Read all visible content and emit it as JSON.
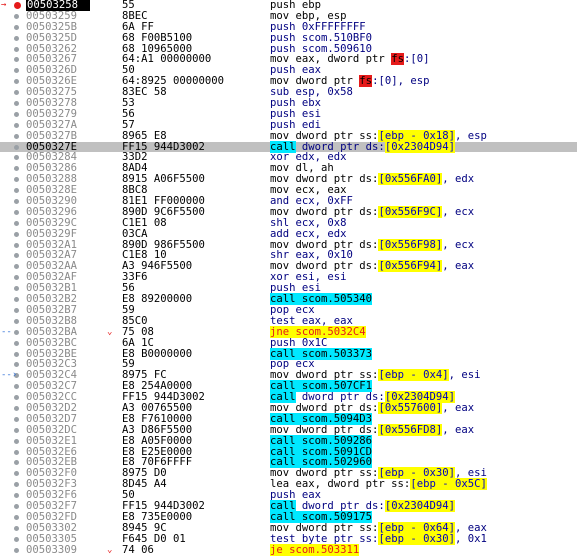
{
  "rows": [
    {
      "addr": "00503258",
      "bytes": "55",
      "ins": [
        {
          "t": "push ebp",
          "k": "mov"
        }
      ],
      "current": true,
      "bp": "red"
    },
    {
      "addr": "00503259",
      "bytes": "8BEC",
      "ins": [
        {
          "t": "mov ebp, esp",
          "k": "mov"
        }
      ]
    },
    {
      "addr": "0050325B",
      "bytes": "6A FF",
      "ins": [
        {
          "t": "push 0xFFFFFFFF",
          "k": "def"
        }
      ]
    },
    {
      "addr": "0050325D",
      "bytes": "68 F00B5100",
      "ins": [
        {
          "t": "push scom.510BF0",
          "k": "def"
        }
      ]
    },
    {
      "addr": "00503262",
      "bytes": "68 10965000",
      "ins": [
        {
          "t": "push scom.509610",
          "k": "def"
        }
      ]
    },
    {
      "addr": "00503267",
      "bytes": "64:A1 00000000",
      "ins": [
        {
          "t": "mov eax, dword ptr ",
          "k": "mov"
        },
        {
          "t": "fs",
          "k": "fs"
        },
        {
          "t": ":[0]",
          "k": "def"
        }
      ]
    },
    {
      "addr": "0050326D",
      "bytes": "50",
      "ins": [
        {
          "t": "push eax",
          "k": "def"
        }
      ]
    },
    {
      "addr": "0050326E",
      "bytes": "64:8925 00000000",
      "ins": [
        {
          "t": "mov dword ptr ",
          "k": "mov"
        },
        {
          "t": "fs",
          "k": "fs"
        },
        {
          "t": ":[0], esp",
          "k": "def"
        }
      ]
    },
    {
      "addr": "00503275",
      "bytes": "83EC 58",
      "ins": [
        {
          "t": "sub esp, 0x58",
          "k": "def"
        }
      ]
    },
    {
      "addr": "00503278",
      "bytes": "53",
      "ins": [
        {
          "t": "push ebx",
          "k": "def"
        }
      ]
    },
    {
      "addr": "00503279",
      "bytes": "56",
      "ins": [
        {
          "t": "push esi",
          "k": "def"
        }
      ]
    },
    {
      "addr": "0050327A",
      "bytes": "57",
      "ins": [
        {
          "t": "push edi",
          "k": "def"
        }
      ]
    },
    {
      "addr": "0050327B",
      "bytes": "8965 E8",
      "ins": [
        {
          "t": "mov dword ptr ss:",
          "k": "mov"
        },
        {
          "t": "[ebp - 0x18]",
          "k": "mem"
        },
        {
          "t": ", esp",
          "k": "def"
        }
      ]
    },
    {
      "addr": "0050327E",
      "bytes": "FF15 944D3002",
      "ins": [
        {
          "t": "call",
          "k": "call"
        },
        {
          "t": " dword ptr ds:",
          "k": "def"
        },
        {
          "t": "[0x2304D94]",
          "k": "mem"
        }
      ],
      "selected": true
    },
    {
      "addr": "00503284",
      "bytes": "33D2",
      "ins": [
        {
          "t": "xor edx, edx",
          "k": "def"
        }
      ]
    },
    {
      "addr": "00503286",
      "bytes": "8AD4",
      "ins": [
        {
          "t": "mov dl, ah",
          "k": "mov"
        }
      ]
    },
    {
      "addr": "00503288",
      "bytes": "8915 A06F5500",
      "ins": [
        {
          "t": "mov dword ptr ds:",
          "k": "mov"
        },
        {
          "t": "[0x556FA0]",
          "k": "mem"
        },
        {
          "t": ", edx",
          "k": "def"
        }
      ]
    },
    {
      "addr": "0050328E",
      "bytes": "8BC8",
      "ins": [
        {
          "t": "mov ecx, eax",
          "k": "mov"
        }
      ]
    },
    {
      "addr": "00503290",
      "bytes": "81E1 FF000000",
      "ins": [
        {
          "t": "and ecx, 0xFF",
          "k": "def"
        }
      ]
    },
    {
      "addr": "00503296",
      "bytes": "890D 9C6F5500",
      "ins": [
        {
          "t": "mov dword ptr ds:",
          "k": "mov"
        },
        {
          "t": "[0x556F9C]",
          "k": "mem"
        },
        {
          "t": ", ecx",
          "k": "def"
        }
      ]
    },
    {
      "addr": "0050329C",
      "bytes": "C1E1 08",
      "ins": [
        {
          "t": "shl ecx, 0x8",
          "k": "def"
        }
      ]
    },
    {
      "addr": "0050329F",
      "bytes": "03CA",
      "ins": [
        {
          "t": "add ecx, edx",
          "k": "def"
        }
      ]
    },
    {
      "addr": "005032A1",
      "bytes": "890D 986F5500",
      "ins": [
        {
          "t": "mov dword ptr ds:",
          "k": "mov"
        },
        {
          "t": "[0x556F98]",
          "k": "mem"
        },
        {
          "t": ", ecx",
          "k": "def"
        }
      ]
    },
    {
      "addr": "005032A7",
      "bytes": "C1E8 10",
      "ins": [
        {
          "t": "shr eax, 0x10",
          "k": "def"
        }
      ]
    },
    {
      "addr": "005032AA",
      "bytes": "A3 946F5500",
      "ins": [
        {
          "t": "mov dword ptr ds:",
          "k": "mov"
        },
        {
          "t": "[0x556F94]",
          "k": "mem"
        },
        {
          "t": ", eax",
          "k": "def"
        }
      ]
    },
    {
      "addr": "005032AF",
      "bytes": "33F6",
      "ins": [
        {
          "t": "xor esi, esi",
          "k": "def"
        }
      ]
    },
    {
      "addr": "005032B1",
      "bytes": "56",
      "ins": [
        {
          "t": "push esi",
          "k": "def"
        }
      ]
    },
    {
      "addr": "005032B2",
      "bytes": "E8 89200000",
      "ins": [
        {
          "t": "call scom.505340",
          "k": "call"
        }
      ]
    },
    {
      "addr": "005032B7",
      "bytes": "59",
      "ins": [
        {
          "t": "pop ecx",
          "k": "def"
        }
      ]
    },
    {
      "addr": "005032B8",
      "bytes": "85C0",
      "ins": [
        {
          "t": "test eax, eax",
          "k": "def"
        }
      ]
    },
    {
      "addr": "005032BA",
      "bytes": "75 08",
      "ins": [
        {
          "t": "jne scom.5032C4",
          "k": "jmp"
        }
      ],
      "jmp": true,
      "arrow": "left"
    },
    {
      "addr": "005032BC",
      "bytes": "6A 1C",
      "ins": [
        {
          "t": "push 0x1C",
          "k": "def"
        }
      ]
    },
    {
      "addr": "005032BE",
      "bytes": "E8 B0000000",
      "ins": [
        {
          "t": "call scom.503373",
          "k": "call"
        }
      ]
    },
    {
      "addr": "005032C3",
      "bytes": "59",
      "ins": [
        {
          "t": "pop ecx",
          "k": "def"
        }
      ]
    },
    {
      "addr": "005032C4",
      "bytes": "8975 FC",
      "ins": [
        {
          "t": "mov dword ptr ss:",
          "k": "mov"
        },
        {
          "t": "[ebp - 0x4]",
          "k": "mem"
        },
        {
          "t": ", esi",
          "k": "def"
        }
      ],
      "arrow": "right"
    },
    {
      "addr": "005032C7",
      "bytes": "E8 254A0000",
      "ins": [
        {
          "t": "call scom.507CF1",
          "k": "call"
        }
      ]
    },
    {
      "addr": "005032CC",
      "bytes": "FF15 944D3002",
      "ins": [
        {
          "t": "call",
          "k": "call"
        },
        {
          "t": " dword ptr ds:",
          "k": "def"
        },
        {
          "t": "[0x2304D94]",
          "k": "mem"
        }
      ]
    },
    {
      "addr": "005032D2",
      "bytes": "A3 00765500",
      "ins": [
        {
          "t": "mov dword ptr ds:",
          "k": "mov"
        },
        {
          "t": "[0x557600]",
          "k": "mem"
        },
        {
          "t": ", eax",
          "k": "def"
        }
      ]
    },
    {
      "addr": "005032D7",
      "bytes": "E8 F7610000",
      "ins": [
        {
          "t": "call scom.5094D3",
          "k": "call"
        }
      ]
    },
    {
      "addr": "005032DC",
      "bytes": "A3 D86F5500",
      "ins": [
        {
          "t": "mov dword ptr ds:",
          "k": "mov"
        },
        {
          "t": "[0x556FD8]",
          "k": "mem"
        },
        {
          "t": ", eax",
          "k": "def"
        }
      ]
    },
    {
      "addr": "005032E1",
      "bytes": "E8 A05F0000",
      "ins": [
        {
          "t": "call scom.509286",
          "k": "call"
        }
      ]
    },
    {
      "addr": "005032E6",
      "bytes": "E8 E25E0000",
      "ins": [
        {
          "t": "call scom.5091CD",
          "k": "call"
        }
      ]
    },
    {
      "addr": "005032EB",
      "bytes": "E8 70F6FFFF",
      "ins": [
        {
          "t": "call scom.502960",
          "k": "call"
        }
      ]
    },
    {
      "addr": "005032F0",
      "bytes": "8975 D0",
      "ins": [
        {
          "t": "mov dword ptr ss:",
          "k": "mov"
        },
        {
          "t": "[ebp - 0x30]",
          "k": "mem"
        },
        {
          "t": ", esi",
          "k": "def"
        }
      ]
    },
    {
      "addr": "005032F3",
      "bytes": "8D45 A4",
      "ins": [
        {
          "t": "lea eax, dword ptr ss:",
          "k": "mov"
        },
        {
          "t": "[ebp - 0x5C]",
          "k": "mem"
        }
      ]
    },
    {
      "addr": "005032F6",
      "bytes": "50",
      "ins": [
        {
          "t": "push eax",
          "k": "def"
        }
      ]
    },
    {
      "addr": "005032F7",
      "bytes": "FF15 944D3002",
      "ins": [
        {
          "t": "call",
          "k": "call"
        },
        {
          "t": " dword ptr ds:",
          "k": "def"
        },
        {
          "t": "[0x2304D94]",
          "k": "mem"
        }
      ]
    },
    {
      "addr": "005032FD",
      "bytes": "E8 735E0000",
      "ins": [
        {
          "t": "call scom.509175",
          "k": "call"
        }
      ]
    },
    {
      "addr": "00503302",
      "bytes": "8945 9C",
      "ins": [
        {
          "t": "mov dword ptr ss:",
          "k": "mov"
        },
        {
          "t": "[ebp - 0x64]",
          "k": "mem"
        },
        {
          "t": ", eax",
          "k": "def"
        }
      ]
    },
    {
      "addr": "00503305",
      "bytes": "F645 D0 01",
      "ins": [
        {
          "t": "test byte ptr ss:",
          "k": "def"
        },
        {
          "t": "[ebp - 0x30]",
          "k": "mem"
        },
        {
          "t": ", 0x1",
          "k": "def"
        }
      ]
    },
    {
      "addr": "00503309",
      "bytes": "74 06",
      "ins": [
        {
          "t": "je scom.503311",
          "k": "jmp"
        }
      ],
      "jmp": true
    }
  ]
}
